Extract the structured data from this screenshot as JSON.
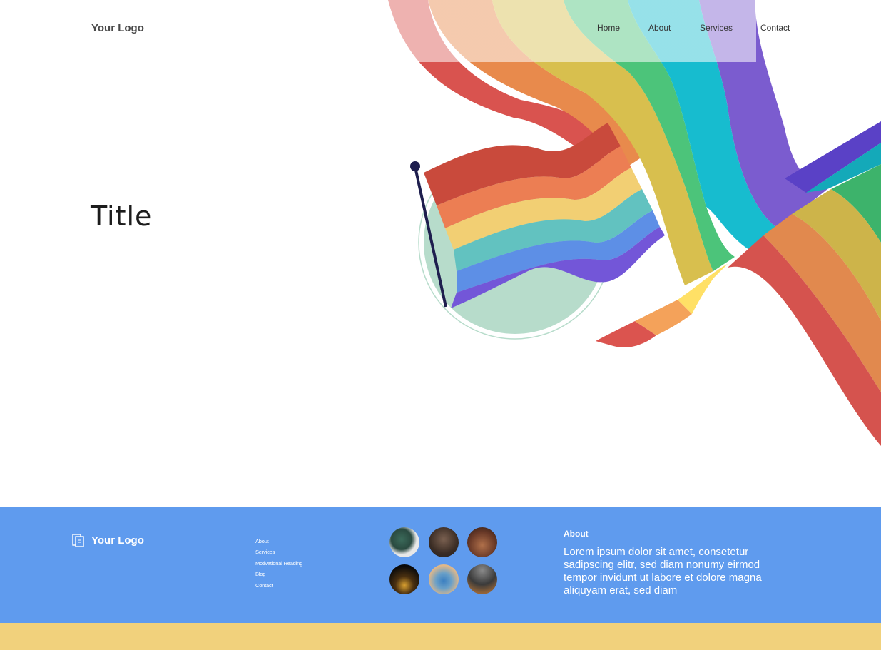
{
  "header": {
    "logo": "Your Logo",
    "nav": [
      "Home",
      "About",
      "Services",
      "Contact"
    ]
  },
  "hero": {
    "title": "Title"
  },
  "footer": {
    "logo": "Your Logo",
    "links": [
      "About",
      "Services",
      "Motivational Reading",
      "Blog",
      "Contact"
    ],
    "about_heading": "About",
    "about_text": "Lorem ipsum dolor sit amet, consetetur sadipscing elitr, sed diam nonumy eirmod tempor invidunt ut labore et dolore magna aliquyam erat, sed diam"
  },
  "colors": {
    "footer_bg": "#5f9bee",
    "bottom_strip": "#f1d17c",
    "circle": "#b7dccb",
    "rainbow": [
      "#d9534f",
      "#ef8a4c",
      "#f4d064",
      "#5ad67d",
      "#1dc7d8",
      "#7a5bd6"
    ]
  }
}
